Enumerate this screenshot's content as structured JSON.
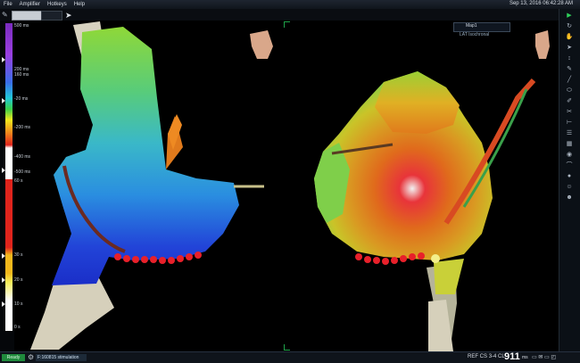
{
  "menu": [
    "File",
    "Amplifier",
    "Hotkeys",
    "Help"
  ],
  "datetime": "Sep 13, 2016 06:42:28 AM",
  "top_map": {
    "name": "Map1",
    "subtitle": "LAT Isochronal"
  },
  "lat_scale": {
    "ticks": [
      "500 ms",
      "200 ms",
      "160 ms",
      "-20 ms",
      "-200 ms",
      "-400 ms",
      "-500 ms"
    ],
    "colors": [
      "#8a2be2",
      "#3a6ee8",
      "#21c8d8",
      "#3ad04b",
      "#f2e81c",
      "#f08a1c",
      "#e0241c"
    ]
  },
  "lower_scale": {
    "ticks": [
      "60 s",
      "30 s",
      "20 s",
      "10 s",
      "0 s"
    ],
    "colors": [
      "#e0241c",
      "#f2b81c",
      "#f7ef5a",
      "#ffffff"
    ]
  },
  "bottom": {
    "status": "Ready",
    "segment": "F:160815 stimulation",
    "ref_label": "REF CS",
    "ref_channel": "3-4",
    "cl_label": "CL",
    "cl_value": "911",
    "cl_unit": "ms"
  }
}
